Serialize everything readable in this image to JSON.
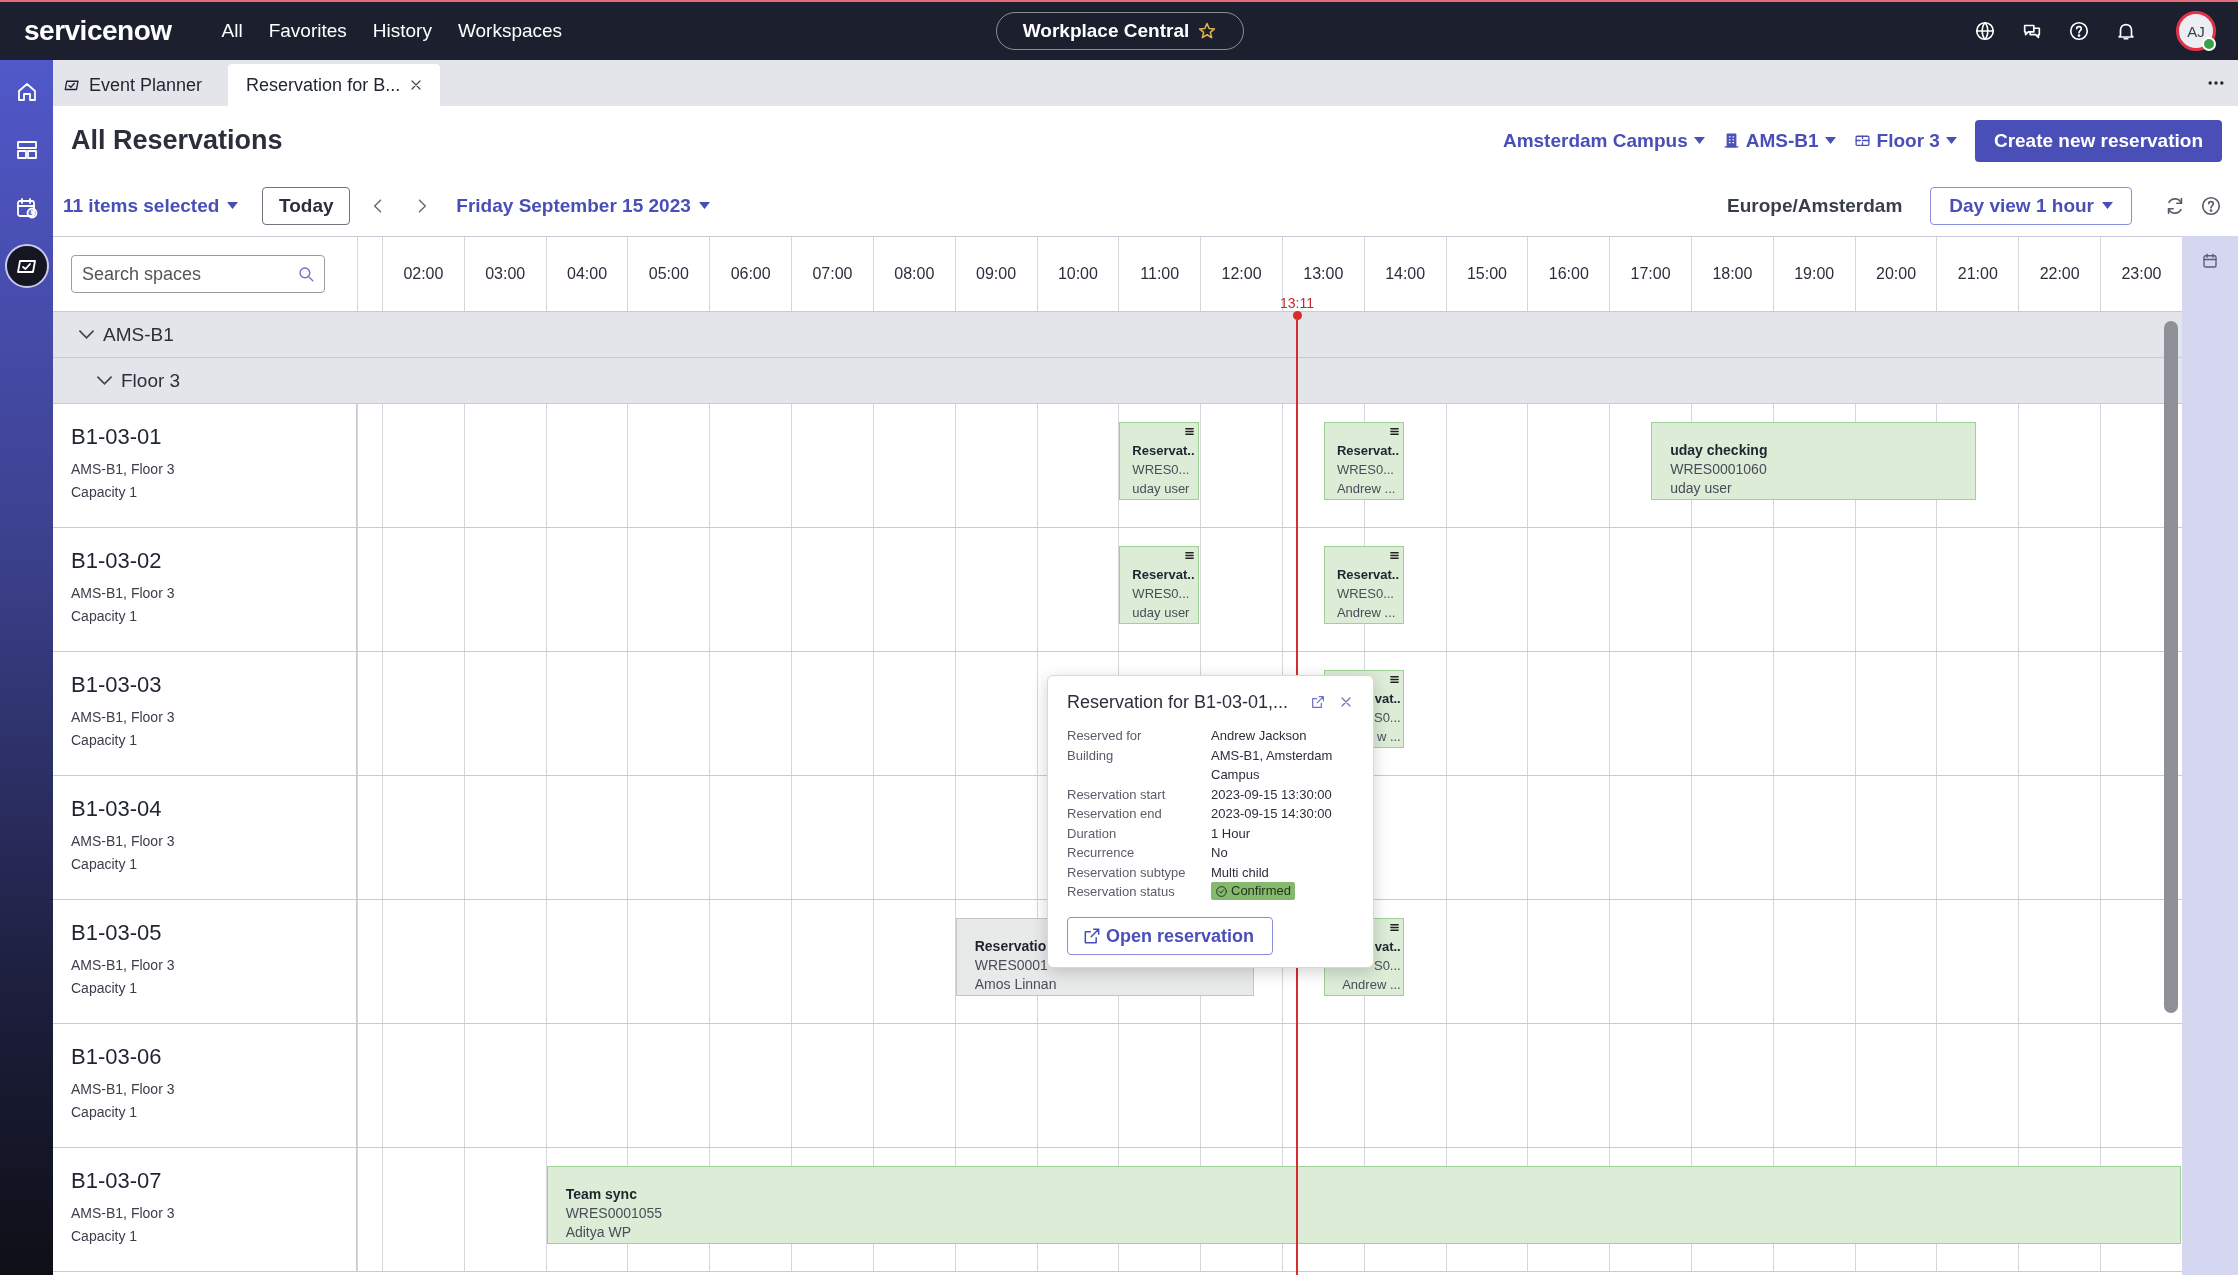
{
  "top_bar": {
    "logo": "servicenow",
    "nav": [
      "All",
      "Favorites",
      "History",
      "Workspaces"
    ],
    "workspace": {
      "label": "Workplace Central",
      "favorite": false
    },
    "avatar": {
      "initials": "AJ",
      "online": true
    }
  },
  "tabs": [
    {
      "label": "Event Planner",
      "selected": false,
      "closable": false
    },
    {
      "label": "Reservation for B...",
      "selected": true,
      "closable": true
    }
  ],
  "sidebar": {
    "items": [
      {
        "selected": false
      },
      {
        "selected": false
      },
      {
        "selected": false
      },
      {
        "selected": true
      }
    ]
  },
  "page": {
    "title": "All Reservations",
    "filters": [
      "Amsterdam Campus",
      "AMS-B1",
      "Floor 3"
    ],
    "create_button": "Create new reservation",
    "selection": "11 items selected",
    "today_button": "Today",
    "date": "Friday September 15 2023",
    "timezone": "Europe/Amsterdam",
    "view": "Day view 1 hour"
  },
  "schedule": {
    "search": {
      "placeholder": "Search spaces"
    },
    "hours": [
      "02:00",
      "03:00",
      "04:00",
      "05:00",
      "06:00",
      "07:00",
      "08:00",
      "09:00",
      "10:00",
      "11:00",
      "12:00",
      "13:00",
      "14:00",
      "15:00",
      "16:00",
      "17:00",
      "18:00",
      "19:00",
      "20:00",
      "21:00",
      "22:00",
      "23:00"
    ],
    "now": "13:11",
    "groups": [
      {
        "label": "AMS-B1",
        "expanded": true,
        "children": [
          {
            "label": "Floor 3",
            "expanded": true,
            "rooms": [
              {
                "name": "B1-03-01",
                "location": "AMS-B1, Floor 3",
                "capacity": "Capacity 1",
                "events": [
                  {
                    "kind": "compact",
                    "title": "Reservat..",
                    "number": "WRES0...",
                    "person": "uday user",
                    "color": "#dcecd7"
                  },
                  {
                    "kind": "compact",
                    "title": "Reservat..",
                    "number": "WRES0...",
                    "person": "Andrew ...",
                    "color": "#dcecd7"
                  },
                  {
                    "kind": "full",
                    "title": "uday checking",
                    "number": "WRES0001060",
                    "person": "uday user",
                    "color": "#dcecd7"
                  }
                ]
              },
              {
                "name": "B1-03-02",
                "location": "AMS-B1, Floor 3",
                "capacity": "Capacity 1",
                "events": [
                  {
                    "kind": "compact",
                    "title": "Reservat..",
                    "number": "WRES0...",
                    "person": "uday user",
                    "color": "#dcecd7"
                  },
                  {
                    "kind": "compact",
                    "title": "Reservat..",
                    "number": "WRES0...",
                    "person": "Andrew ...",
                    "color": "#dcecd7"
                  }
                ]
              },
              {
                "name": "B1-03-03",
                "location": "AMS-B1, Floor 3",
                "capacity": "Capacity 1",
                "events": [
                  {
                    "kind": "partial",
                    "title": "vat..",
                    "number": "S0...",
                    "person": "w ...",
                    "color": "#dcecd7"
                  }
                ]
              },
              {
                "name": "B1-03-04",
                "location": "AMS-B1, Floor 3",
                "capacity": "Capacity 1"
              },
              {
                "name": "B1-03-05",
                "location": "AMS-B1, Floor 3",
                "capacity": "Capacity 1",
                "events": [
                  {
                    "kind": "full",
                    "title": "Reservatio",
                    "number": "WRES0001",
                    "person": "Amos Linnan",
                    "color": "#e8e9e9"
                  },
                  {
                    "kind": "partial",
                    "title": "vat..",
                    "number": "S0...",
                    "person": "Andrew ...",
                    "color": "#dcecd7"
                  }
                ]
              },
              {
                "name": "B1-03-06",
                "location": "AMS-B1, Floor 3",
                "capacity": "Capacity 1"
              },
              {
                "name": "B1-03-07",
                "location": "AMS-B1, Floor 3",
                "capacity": "Capacity 1",
                "events": [
                  {
                    "kind": "full",
                    "title": "Team sync",
                    "number": "WRES0001055",
                    "person": "Aditya WP",
                    "color": "#dcecd7"
                  }
                ]
              }
            ]
          }
        ]
      }
    ]
  },
  "popup": {
    "title": "Reservation for B1-03-01,...",
    "details": [
      {
        "label": "Reserved for",
        "value": "Andrew Jackson",
        "kind": "text"
      },
      {
        "label": "Building",
        "value": "AMS-B1, Amsterdam Campus",
        "kind": "text"
      },
      {
        "label": "Reservation start",
        "value": "2023-09-15 13:30:00",
        "kind": "text"
      },
      {
        "label": "Reservation end",
        "value": "2023-09-15 14:30:00",
        "kind": "text"
      },
      {
        "label": "Duration",
        "value": "1 Hour",
        "kind": "text"
      },
      {
        "label": "Recurrence",
        "value": "No",
        "kind": "text"
      },
      {
        "label": "Reservation subtype",
        "value": "Multi child",
        "kind": "text"
      },
      {
        "label": "Reservation status",
        "value": "Confirmed",
        "kind": "badge"
      }
    ],
    "button": "Open reservation"
  }
}
